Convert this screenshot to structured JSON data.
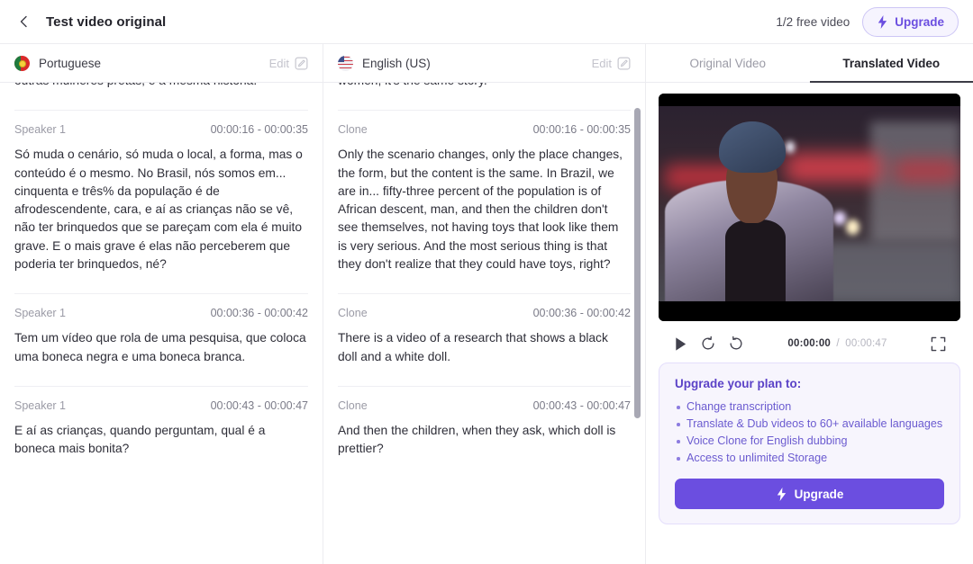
{
  "header": {
    "back_icon": "chevron-left-icon",
    "title": "Test video original",
    "free_video_label": "1/2 free video",
    "upgrade_label": "Upgrade",
    "bolt_icon": "bolt-icon"
  },
  "languages": {
    "source": {
      "name": "Portuguese",
      "flag_icon": "flag-portugal-icon",
      "edit_label": "Edit",
      "edit_icon": "pencil-square-icon"
    },
    "target": {
      "name": "English (US)",
      "flag_icon": "flag-usa-icon",
      "edit_label": "Edit",
      "edit_icon": "pencil-square-icon"
    }
  },
  "transcript": {
    "source_segments": [
      {
        "speaker": "",
        "time": "",
        "text": "outras mulheres pretas, é a mesma história."
      },
      {
        "speaker": "Speaker 1",
        "time": "00:00:16 - 00:00:35",
        "text": "Só muda o cenário, só muda o local, a forma, mas o conteúdo é o mesmo. No Brasil, nós somos em... cinquenta e três% da população é de afrodescendente, cara, e aí as crianças não se vê, não ter brinquedos que se pareçam com ela é muito grave. E o mais grave é elas não perceberem que poderia ter brinquedos, né?"
      },
      {
        "speaker": "Speaker 1",
        "time": "00:00:36 - 00:00:42",
        "text": "Tem um vídeo que rola de uma pesquisa, que coloca uma boneca negra e uma boneca branca."
      },
      {
        "speaker": "Speaker 1",
        "time": "00:00:43 - 00:00:47",
        "text": "E aí as crianças, quando perguntam, qual é a boneca mais bonita?"
      }
    ],
    "target_segments": [
      {
        "speaker": "",
        "time": "",
        "text": "women, it's the same story."
      },
      {
        "speaker": "Clone",
        "time": "00:00:16 - 00:00:35",
        "text": "Only the scenario changes, only the place changes, the form, but the content is the same. In Brazil, we are in... fifty-three percent of the population is of African descent, man, and then the children don't see themselves, not having toys that look like them is very serious. And the most serious thing is that they don't realize that they could have toys, right?"
      },
      {
        "speaker": "Clone",
        "time": "00:00:36 - 00:00:42",
        "text": "There is a video of a research that shows a black doll and a white doll."
      },
      {
        "speaker": "Clone",
        "time": "00:00:43 - 00:00:47",
        "text": "And then the children, when they ask, which doll is prettier?"
      }
    ]
  },
  "video_tabs": [
    {
      "label": "Original Video",
      "active": false
    },
    {
      "label": "Translated Video",
      "active": true
    }
  ],
  "player": {
    "play_icon": "play-icon",
    "rewind_icon": "rewind-10-icon",
    "forward_icon": "forward-10-icon",
    "fullscreen_icon": "fullscreen-icon",
    "current_time": "00:00:00",
    "time_separator": "/",
    "total_time": "00:00:47"
  },
  "upgrade_card": {
    "title": "Upgrade your plan to:",
    "benefits": [
      "Change transcription",
      "Translate & Dub videos to 60+ available languages",
      "Voice Clone for English dubbing",
      "Access to unlimited Storage"
    ],
    "button_label": "Upgrade",
    "bolt_icon": "bolt-icon"
  },
  "colors": {
    "accent": "#6b4ee0",
    "accent_soft": "#f7f5fd",
    "text_primary": "#23232b",
    "text_muted": "#9b9ba6"
  }
}
